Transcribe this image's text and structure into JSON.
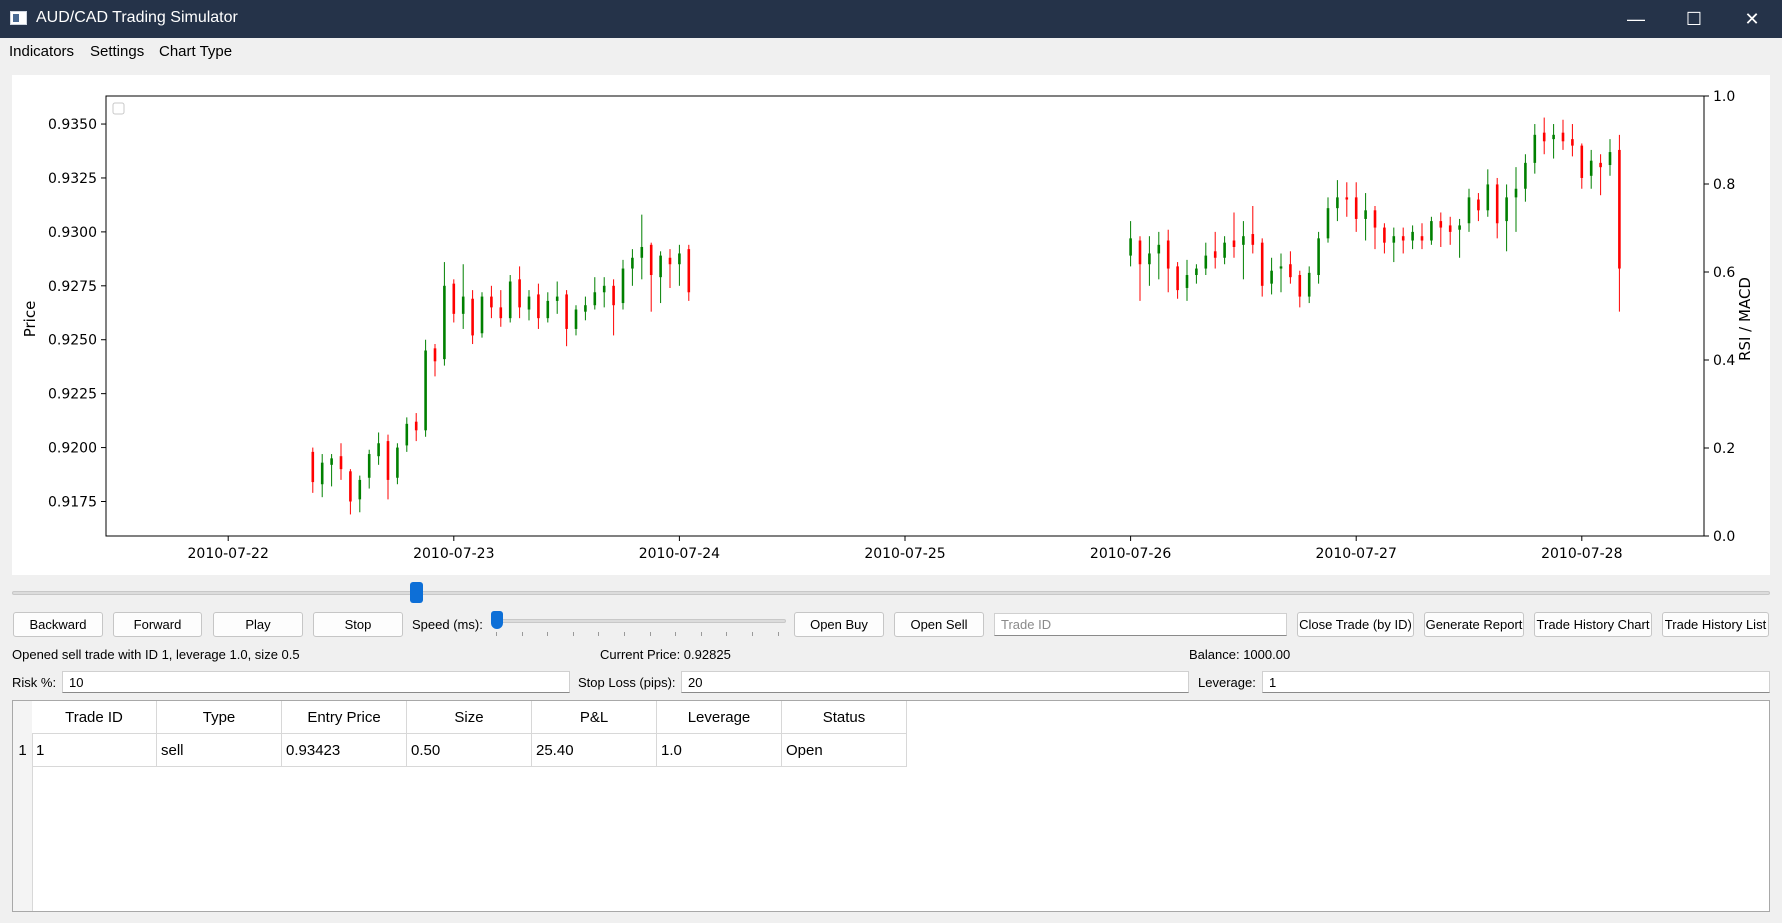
{
  "window": {
    "title": "AUD/CAD Trading Simulator",
    "minimize": "—",
    "maximize": "☐",
    "close": "✕"
  },
  "menu": [
    "Indicators",
    "Settings",
    "Chart Type"
  ],
  "chart": {
    "y_label": "Price",
    "y2_label": "RSI / MACD",
    "y_ticks": [
      "0.9175",
      "0.9200",
      "0.9225",
      "0.9250",
      "0.9275",
      "0.9300",
      "0.9325",
      "0.9350"
    ],
    "y2_ticks": [
      "0.0",
      "0.2",
      "0.4",
      "0.6",
      "0.8",
      "1.0"
    ],
    "x_ticks": [
      "2010-07-22",
      "2010-07-23",
      "2010-07-24",
      "2010-07-25",
      "2010-07-26",
      "2010-07-27",
      "2010-07-28"
    ],
    "up_color": "#008000",
    "down_color": "#ff0000"
  },
  "chart_data": {
    "type": "candlestick",
    "y_range": [
      0.9159,
      0.9363
    ],
    "y2_range": [
      0.0,
      1.0
    ],
    "x_range": [
      "2010-07-21 11:00",
      "2010-07-28 13:00"
    ],
    "candles": [
      [
        "2010-07-22 09:00",
        0.9198,
        0.92,
        0.9179,
        0.9184
      ],
      [
        "2010-07-22 10:00",
        0.9183,
        0.9197,
        0.9177,
        0.9193
      ],
      [
        "2010-07-22 11:00",
        0.9192,
        0.9197,
        0.9182,
        0.9195
      ],
      [
        "2010-07-22 12:00",
        0.9196,
        0.9202,
        0.9185,
        0.919
      ],
      [
        "2010-07-22 13:00",
        0.9189,
        0.919,
        0.9169,
        0.9175
      ],
      [
        "2010-07-22 14:00",
        0.9176,
        0.9187,
        0.917,
        0.9185
      ],
      [
        "2010-07-22 15:00",
        0.9186,
        0.9199,
        0.9181,
        0.9197
      ],
      [
        "2010-07-22 16:00",
        0.9196,
        0.9207,
        0.9192,
        0.9202
      ],
      [
        "2010-07-22 17:00",
        0.9203,
        0.9206,
        0.9176,
        0.9185
      ],
      [
        "2010-07-22 18:00",
        0.9186,
        0.9202,
        0.9183,
        0.92
      ],
      [
        "2010-07-22 19:00",
        0.9201,
        0.9214,
        0.9198,
        0.9211
      ],
      [
        "2010-07-22 20:00",
        0.9212,
        0.9216,
        0.9203,
        0.9208
      ],
      [
        "2010-07-22 21:00",
        0.9208,
        0.925,
        0.9205,
        0.9245
      ],
      [
        "2010-07-22 22:00",
        0.9246,
        0.9248,
        0.9233,
        0.924
      ],
      [
        "2010-07-22 23:00",
        0.9241,
        0.9286,
        0.9238,
        0.9275
      ],
      [
        "2010-07-23 00:00",
        0.9276,
        0.9278,
        0.9258,
        0.9262
      ],
      [
        "2010-07-23 01:00",
        0.9262,
        0.9285,
        0.9255,
        0.927
      ],
      [
        "2010-07-23 02:00",
        0.9269,
        0.9273,
        0.9248,
        0.9252
      ],
      [
        "2010-07-23 03:00",
        0.9253,
        0.9272,
        0.9251,
        0.927
      ],
      [
        "2010-07-23 04:00",
        0.927,
        0.9275,
        0.926,
        0.9265
      ],
      [
        "2010-07-23 05:00",
        0.9265,
        0.9273,
        0.9256,
        0.926
      ],
      [
        "2010-07-23 06:00",
        0.926,
        0.928,
        0.9258,
        0.9277
      ],
      [
        "2010-07-23 07:00",
        0.9278,
        0.9284,
        0.926,
        0.9265
      ],
      [
        "2010-07-23 08:00",
        0.9264,
        0.9273,
        0.9259,
        0.927
      ],
      [
        "2010-07-23 09:00",
        0.9271,
        0.9276,
        0.9255,
        0.926
      ],
      [
        "2010-07-23 10:00",
        0.926,
        0.9272,
        0.9258,
        0.9268
      ],
      [
        "2010-07-23 11:00",
        0.9268,
        0.9277,
        0.9262,
        0.927
      ],
      [
        "2010-07-23 12:00",
        0.9271,
        0.9273,
        0.9247,
        0.9255
      ],
      [
        "2010-07-23 13:00",
        0.9255,
        0.9266,
        0.9252,
        0.9264
      ],
      [
        "2010-07-23 14:00",
        0.9263,
        0.927,
        0.9259,
        0.9266
      ],
      [
        "2010-07-23 15:00",
        0.9266,
        0.9279,
        0.9264,
        0.9272
      ],
      [
        "2010-07-23 16:00",
        0.9272,
        0.9279,
        0.9265,
        0.9275
      ],
      [
        "2010-07-23 17:00",
        0.9275,
        0.9278,
        0.9252,
        0.9266
      ],
      [
        "2010-07-23 18:00",
        0.9267,
        0.9287,
        0.9264,
        0.9283
      ],
      [
        "2010-07-23 19:00",
        0.9283,
        0.9292,
        0.9275,
        0.9288
      ],
      [
        "2010-07-23 20:00",
        0.9288,
        0.9308,
        0.9278,
        0.9293
      ],
      [
        "2010-07-23 21:00",
        0.9294,
        0.9295,
        0.9263,
        0.928
      ],
      [
        "2010-07-23 22:00",
        0.9279,
        0.9291,
        0.9267,
        0.9289
      ],
      [
        "2010-07-23 23:00",
        0.9288,
        0.9292,
        0.9274,
        0.9285
      ],
      [
        "2010-07-24 00:00",
        0.9285,
        0.9294,
        0.9275,
        0.929
      ],
      [
        "2010-07-24 01:00",
        0.9292,
        0.9294,
        0.9268,
        0.9272
      ],
      [
        "2010-07-26 00:00",
        0.9289,
        0.9305,
        0.9284,
        0.9297
      ],
      [
        "2010-07-26 01:00",
        0.9296,
        0.9298,
        0.9268,
        0.9285
      ],
      [
        "2010-07-26 02:00",
        0.9285,
        0.9298,
        0.9275,
        0.929
      ],
      [
        "2010-07-26 03:00",
        0.929,
        0.93,
        0.9278,
        0.9294
      ],
      [
        "2010-07-26 04:00",
        0.9296,
        0.9301,
        0.9272,
        0.9283
      ],
      [
        "2010-07-26 05:00",
        0.9284,
        0.9286,
        0.9269,
        0.9273
      ],
      [
        "2010-07-26 06:00",
        0.9274,
        0.9287,
        0.9268,
        0.928
      ],
      [
        "2010-07-26 07:00",
        0.928,
        0.9285,
        0.9276,
        0.9283
      ],
      [
        "2010-07-26 08:00",
        0.9283,
        0.9295,
        0.928,
        0.9289
      ],
      [
        "2010-07-26 09:00",
        0.9291,
        0.93,
        0.9283,
        0.9288
      ],
      [
        "2010-07-26 10:00",
        0.9288,
        0.9298,
        0.9285,
        0.9295
      ],
      [
        "2010-07-26 11:00",
        0.9296,
        0.9309,
        0.9288,
        0.9293
      ],
      [
        "2010-07-26 12:00",
        0.9294,
        0.9305,
        0.9278,
        0.9298
      ],
      [
        "2010-07-26 13:00",
        0.9299,
        0.9312,
        0.929,
        0.9294
      ],
      [
        "2010-07-26 14:00",
        0.9295,
        0.9297,
        0.927,
        0.9275
      ],
      [
        "2010-07-26 15:00",
        0.9276,
        0.9288,
        0.9271,
        0.9282
      ],
      [
        "2010-07-26 16:00",
        0.9283,
        0.929,
        0.9272,
        0.9284
      ],
      [
        "2010-07-26 17:00",
        0.9285,
        0.9291,
        0.9276,
        0.9279
      ],
      [
        "2010-07-26 18:00",
        0.928,
        0.9282,
        0.9265,
        0.927
      ],
      [
        "2010-07-26 19:00",
        0.927,
        0.9284,
        0.9267,
        0.9281
      ],
      [
        "2010-07-26 20:00",
        0.928,
        0.93,
        0.9276,
        0.9297
      ],
      [
        "2010-07-26 21:00",
        0.9297,
        0.9316,
        0.9295,
        0.9311
      ],
      [
        "2010-07-26 22:00",
        0.9311,
        0.9324,
        0.9305,
        0.9316
      ],
      [
        "2010-07-26 23:00",
        0.9316,
        0.9323,
        0.9307,
        0.9315
      ],
      [
        "2010-07-27 00:00",
        0.9316,
        0.9323,
        0.93,
        0.9306
      ],
      [
        "2010-07-27 01:00",
        0.9306,
        0.9318,
        0.9296,
        0.931
      ],
      [
        "2010-07-27 02:00",
        0.931,
        0.9312,
        0.9292,
        0.9302
      ],
      [
        "2010-07-27 03:00",
        0.9302,
        0.9304,
        0.929,
        0.9295
      ],
      [
        "2010-07-27 04:00",
        0.9295,
        0.9302,
        0.9286,
        0.9298
      ],
      [
        "2010-07-27 05:00",
        0.9298,
        0.9302,
        0.929,
        0.9296
      ],
      [
        "2010-07-27 06:00",
        0.9296,
        0.9303,
        0.9292,
        0.93
      ],
      [
        "2010-07-27 07:00",
        0.9298,
        0.9304,
        0.9292,
        0.9296
      ],
      [
        "2010-07-27 08:00",
        0.9296,
        0.9307,
        0.9294,
        0.9305
      ],
      [
        "2010-07-27 09:00",
        0.9305,
        0.9309,
        0.9293,
        0.9302
      ],
      [
        "2010-07-27 10:00",
        0.9303,
        0.9307,
        0.9294,
        0.93
      ],
      [
        "2010-07-27 11:00",
        0.9301,
        0.9306,
        0.9288,
        0.9303
      ],
      [
        "2010-07-27 12:00",
        0.9304,
        0.932,
        0.93,
        0.9316
      ],
      [
        "2010-07-27 13:00",
        0.9315,
        0.9318,
        0.9305,
        0.931
      ],
      [
        "2010-07-27 14:00",
        0.931,
        0.9329,
        0.9307,
        0.9322
      ],
      [
        "2010-07-27 15:00",
        0.9322,
        0.9325,
        0.9297,
        0.9304
      ],
      [
        "2010-07-27 16:00",
        0.9305,
        0.9322,
        0.9291,
        0.9316
      ],
      [
        "2010-07-27 17:00",
        0.9316,
        0.933,
        0.93,
        0.932
      ],
      [
        "2010-07-27 18:00",
        0.932,
        0.9336,
        0.9314,
        0.9332
      ],
      [
        "2010-07-27 19:00",
        0.9332,
        0.935,
        0.9327,
        0.9345
      ],
      [
        "2010-07-27 20:00",
        0.9346,
        0.9353,
        0.9336,
        0.9342
      ],
      [
        "2010-07-27 21:00",
        0.9343,
        0.935,
        0.9334,
        0.9345
      ],
      [
        "2010-07-27 22:00",
        0.9346,
        0.9352,
        0.9338,
        0.9342
      ],
      [
        "2010-07-27 23:00",
        0.9343,
        0.935,
        0.9335,
        0.934
      ],
      [
        "2010-07-28 00:00",
        0.934,
        0.9341,
        0.932,
        0.9325
      ],
      [
        "2010-07-28 01:00",
        0.9326,
        0.9338,
        0.932,
        0.9333
      ],
      [
        "2010-07-28 02:00",
        0.9332,
        0.9336,
        0.9317,
        0.933
      ],
      [
        "2010-07-28 03:00",
        0.9331,
        0.9343,
        0.9326,
        0.9337
      ],
      [
        "2010-07-28 04:00",
        0.9338,
        0.9345,
        0.9263,
        0.9283
      ]
    ]
  },
  "controls": {
    "backward": "Backward",
    "forward": "Forward",
    "play": "Play",
    "stop": "Stop",
    "speed_label": "Speed (ms):",
    "speed_value": 0.0,
    "open_buy": "Open Buy",
    "open_sell": "Open Sell",
    "trade_id_placeholder": "Trade ID",
    "close_trade": "Close Trade (by ID)",
    "generate_report": "Generate Report",
    "history_chart": "Trade History Chart",
    "history_list": "Trade History List"
  },
  "timeline": {
    "position": 0.228
  },
  "status": {
    "message": "Opened sell trade with ID 1, leverage 1.0, size 0.5",
    "current_price": "Current Price: 0.92825",
    "balance": "Balance: 1000.00"
  },
  "params": {
    "risk_label": "Risk %:",
    "risk_value": "10",
    "stop_loss_label": "Stop Loss (pips):",
    "stop_loss_value": "20",
    "leverage_label": "Leverage:",
    "leverage_value": "1"
  },
  "table": {
    "headers": [
      "Trade ID",
      "Type",
      "Entry Price",
      "Size",
      "P&L",
      "Leverage",
      "Status"
    ],
    "row_numbers": [
      "1"
    ],
    "rows": [
      [
        "1",
        "sell",
        "0.93423",
        "0.50",
        "25.40",
        "1.0",
        "Open"
      ]
    ]
  }
}
